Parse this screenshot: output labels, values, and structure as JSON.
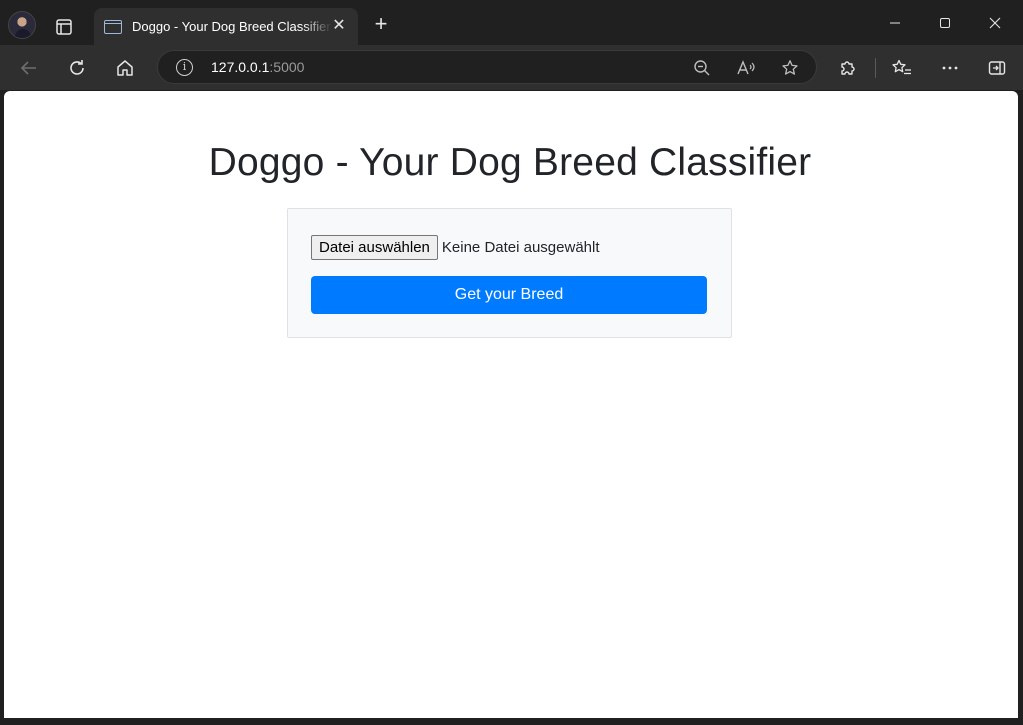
{
  "browser": {
    "tab": {
      "title": "Doggo - Your Dog Breed Classifier"
    },
    "address": {
      "host": "127.0.0.1",
      "port": ":5000"
    }
  },
  "page": {
    "heading": "Doggo - Your Dog Breed Classifier",
    "upload": {
      "file_button_label": "Datei auswählen",
      "file_status": "Keine Datei ausgewählt",
      "submit_label": "Get your Breed"
    }
  },
  "colors": {
    "primary": "#007bff",
    "heading": "#212529",
    "card_bg": "#f8f9fa"
  }
}
